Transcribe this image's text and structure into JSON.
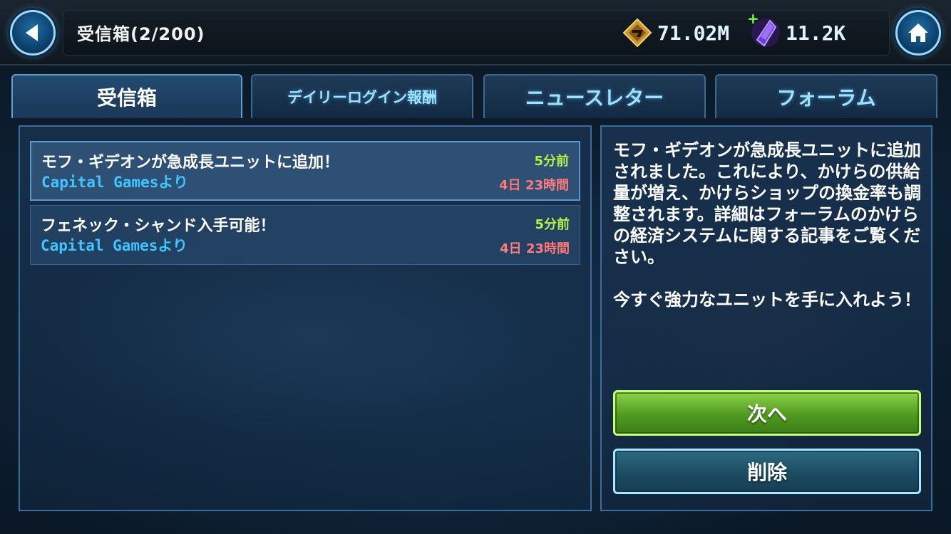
{
  "header": {
    "title": "受信箱(2/200)",
    "credits": "71.02M",
    "crystals": "11.2K",
    "crystals_plus": "+",
    "icons": {
      "back": "back-arrow-icon",
      "home": "home-icon",
      "credits": "credits-icon",
      "crystals": "crystal-icon"
    }
  },
  "tabs": [
    {
      "label": "受信箱",
      "active": true
    },
    {
      "label": "デイリーログイン報酬",
      "active": false
    },
    {
      "label": "ニュースレター",
      "active": false
    },
    {
      "label": "フォーラム",
      "active": false
    }
  ],
  "messages": [
    {
      "subject": "モフ・ギデオンが急成長ユニットに追加！",
      "sender": "Capital Gamesより",
      "age": "5分前",
      "expires": "4日 23時間",
      "selected": true
    },
    {
      "subject": "フェネック・シャンド入手可能！",
      "sender": "Capital Gamesより",
      "age": "5分前",
      "expires": "4日 23時間",
      "selected": false
    }
  ],
  "detail": {
    "body": "モフ・ギデオンが急成長ユニットに追加されました。これにより、かけらの供給量が増え、かけらショップの換金率も調整されます。詳細はフォーラムのかけらの経済システムに関する記事をご覧ください。\n\n今すぐ強力なユニットを手に入れよう！",
    "next_label": "次へ",
    "delete_label": "削除"
  },
  "colors": {
    "sender": "#41c4ff",
    "age": "#b6f04a",
    "expires": "#ff7a7a",
    "next_button": "#5aa82a",
    "delete_button": "#1f5670"
  }
}
